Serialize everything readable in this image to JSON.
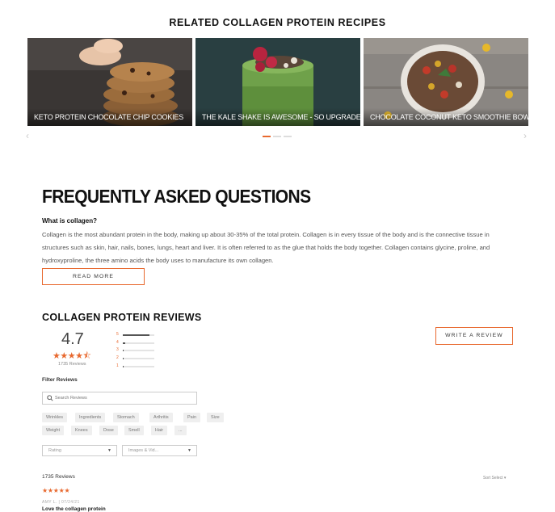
{
  "related": {
    "title": "RELATED COLLAGEN PROTEIN RECIPES",
    "cards": [
      {
        "caption": "KETO PROTEIN CHOCOLATE CHIP COOKIES"
      },
      {
        "caption": "THE KALE SHAKE IS AWESOME - SO UPGRADE IT"
      },
      {
        "caption": "CHOCOLATE COCONUT KETO SMOOTHIE BOWL"
      }
    ],
    "prev_icon": "chevron-left-icon",
    "next_icon": "chevron-right-icon"
  },
  "faq": {
    "title": "FREQUENTLY ASKED QUESTIONS",
    "question": "What is collagen?",
    "answer": "Collagen is the most abundant protein in the body, making up about 30-35% of the total protein. Collagen is in every tissue of the body and is the connective tissue in structures such as skin, hair, nails, bones, lungs, heart and liver. It is often referred to as the glue that holds the body together. Collagen contains glycine, proline, and hydroxyproline, the three amino acids the body uses to manufacture its own collagen.",
    "read_more": "READ MORE"
  },
  "reviews": {
    "title": "COLLAGEN PROTEIN REVIEWS",
    "average": "4.7",
    "stars": "★★★★⯪",
    "count_label": "1735 Reviews",
    "write_review": "WRITE A REVIEW",
    "distribution": [
      {
        "star": "5",
        "fraction": 0.85
      },
      {
        "star": "4",
        "fraction": 0.08
      },
      {
        "star": "3",
        "fraction": 0.03
      },
      {
        "star": "2",
        "fraction": 0.01
      },
      {
        "star": "1",
        "fraction": 0.03
      }
    ],
    "filter_label": "Filter Reviews",
    "search_placeholder": "Search Reviews",
    "chips_row1": [
      "Wrinkles",
      "Ingredients",
      "Stomach",
      "Arthritis",
      "Pain",
      "Size"
    ],
    "chips_row2": [
      "Weight",
      "Knees",
      "Dose",
      "Smell",
      "Hair",
      "..."
    ],
    "rating_select": "Rating",
    "media_select": "Images & Vid...",
    "total": "1735 Reviews",
    "sort": "Sort Select ▾",
    "first_review": {
      "stars": "★★★★★",
      "meta": "AMY L.  |  07/24/21",
      "title": "Love the collagen protein"
    },
    "accent_color": "#e8692f"
  }
}
